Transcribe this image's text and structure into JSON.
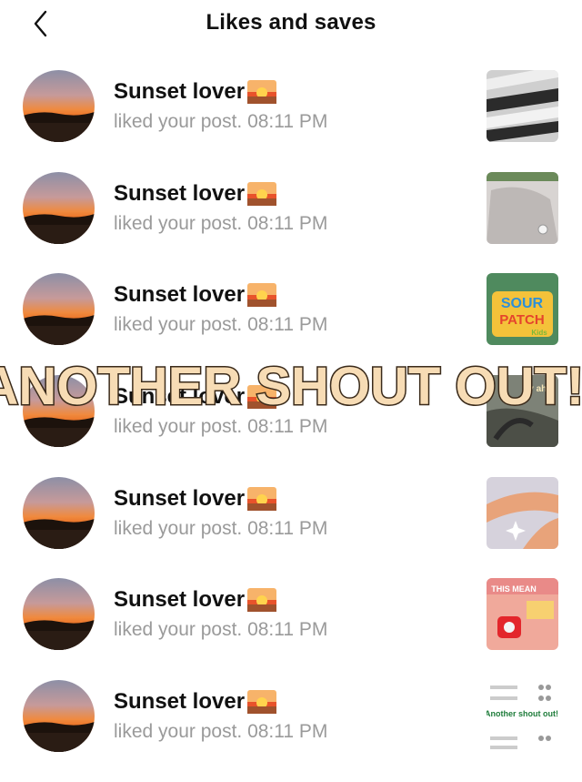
{
  "header": {
    "title": "Likes and saves",
    "back_icon": "chevron-left-icon"
  },
  "notifications": [
    {
      "name": "Sunset lover",
      "emoji": "sunrise-emoji",
      "action": "liked your post. 08:11 PM"
    },
    {
      "name": "Sunset lover",
      "emoji": "sunrise-emoji",
      "action": "liked your post. 08:11 PM"
    },
    {
      "name": "Sunset lover",
      "emoji": "sunrise-emoji",
      "action": "liked your post. 08:11 PM"
    },
    {
      "name": "Sunset lover",
      "emoji": "sunrise-emoji",
      "action": "liked your post. 08:11 PM"
    },
    {
      "name": "Sunset lover",
      "emoji": "sunrise-emoji",
      "action": "liked your post. 08:11 PM"
    },
    {
      "name": "Sunset lover",
      "emoji": "sunrise-emoji",
      "action": "liked your post. 08:11 PM"
    },
    {
      "name": "Sunset lover",
      "emoji": "sunrise-emoji",
      "action": "liked your post. 08:11 PM"
    }
  ],
  "overlay": {
    "text": "ANOTHER SHOUT OUT!!",
    "fill": "#f7dcb5",
    "stroke": "#3a2a1a"
  },
  "thumb_texts": {
    "t3_top": "SOUR",
    "t3_bottom": "PATCH",
    "t3_small": "Kids",
    "t4_label": "tty ahh",
    "t6_title": "THIS MEAN",
    "t7_caption": "Another shout out!!"
  },
  "colors": {
    "muted": "#9a9a9a",
    "text": "#111111"
  }
}
